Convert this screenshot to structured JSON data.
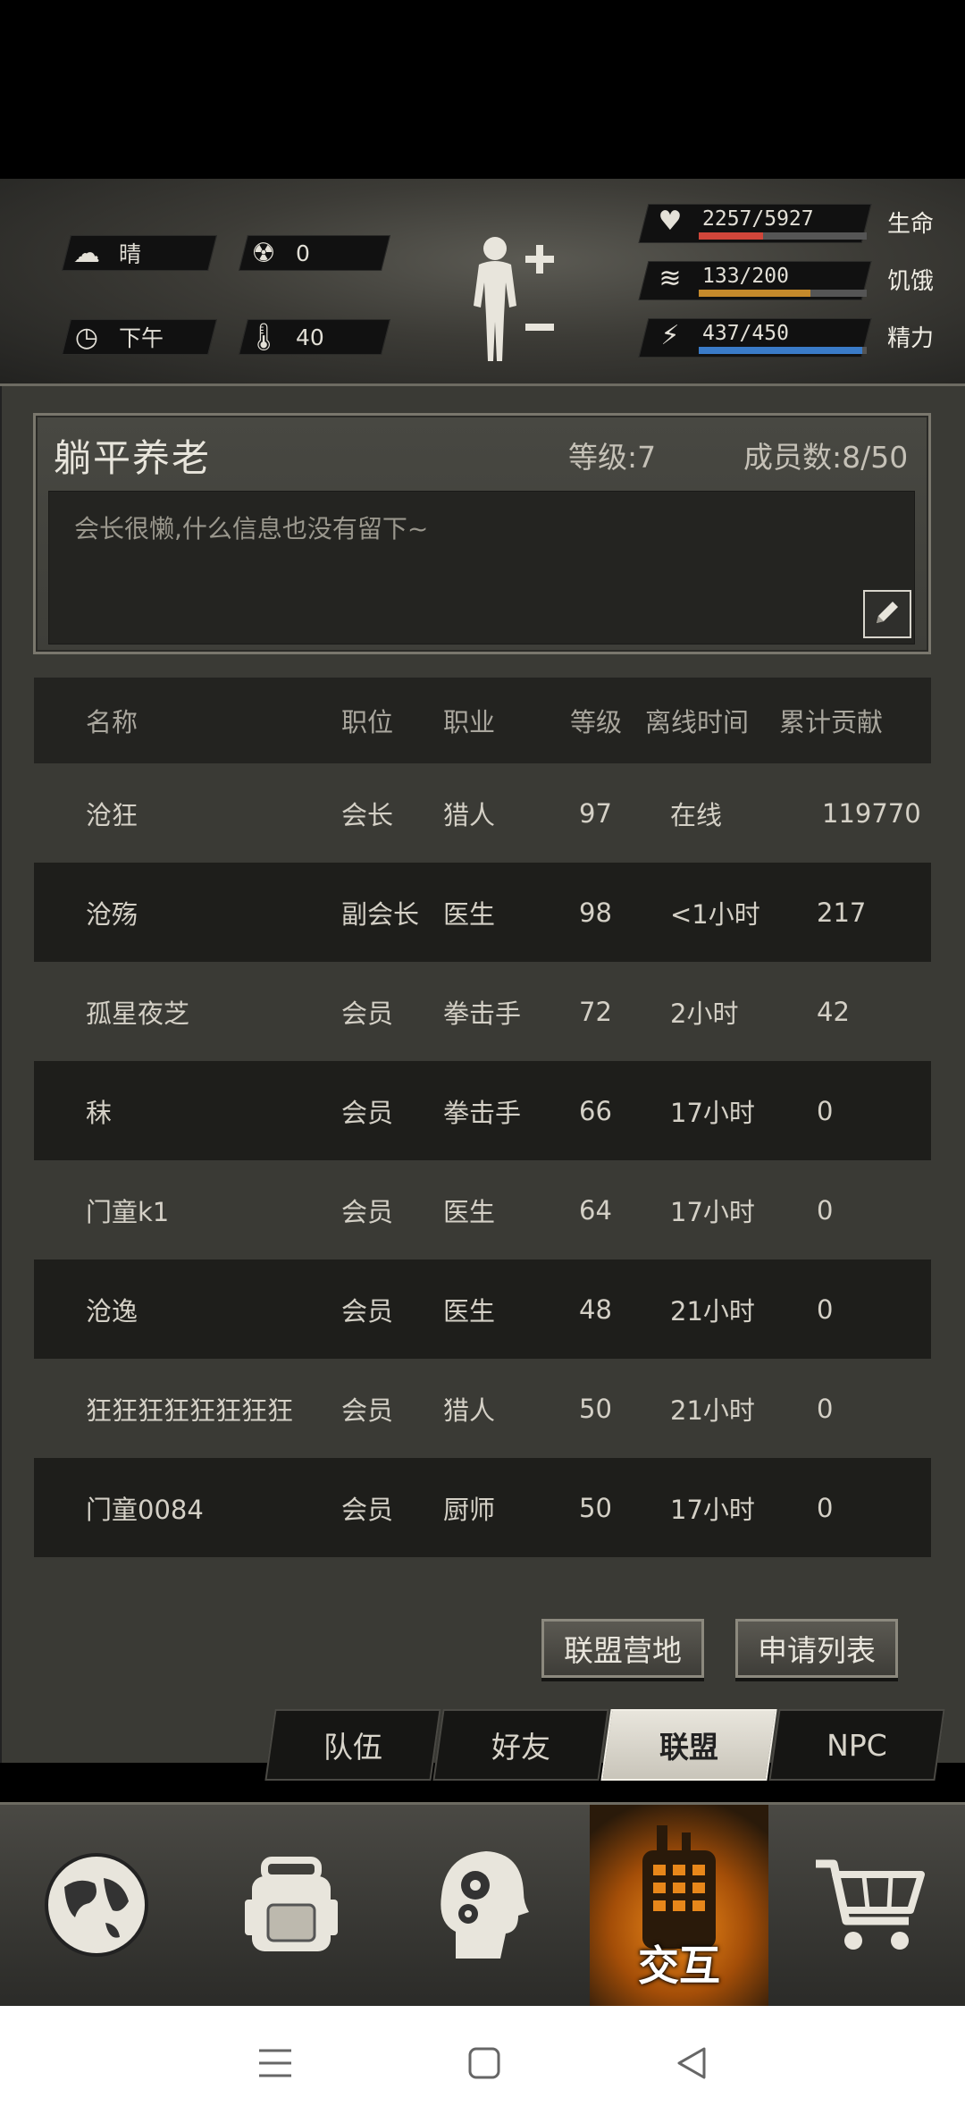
{
  "hud": {
    "weather": "晴",
    "radiation": "0",
    "time_of_day": "下午",
    "temperature": "40",
    "stats": [
      {
        "icon": "heart-icon",
        "value": "2257/5927",
        "label": "生命",
        "fraction": 0.381,
        "color": "#d0463a"
      },
      {
        "icon": "stomach-icon",
        "value": "133/200",
        "label": "饥饿",
        "fraction": 0.665,
        "color": "#c58a2b"
      },
      {
        "icon": "energy-icon",
        "value": "437/450",
        "label": "精力",
        "fraction": 0.971,
        "color": "#3a7bc8"
      }
    ]
  },
  "guild": {
    "name": "躺平养老",
    "level": "等级:7",
    "members": "成员数:8/50",
    "notice": "会长很懒,什么信息也没有留下~"
  },
  "table": {
    "headers": [
      "名称",
      "职位",
      "职业",
      "等级",
      "离线时间",
      "累计贡献"
    ],
    "rows": [
      [
        "沧狂",
        "会长",
        "猎人",
        "97",
        "在线",
        "119770"
      ],
      [
        "沧殇",
        "副会长",
        "医生",
        "98",
        "<1小时",
        "217"
      ],
      [
        "孤星夜芝",
        "会员",
        "拳击手",
        "72",
        "2小时",
        "42"
      ],
      [
        "秣",
        "会员",
        "拳击手",
        "66",
        "17小时",
        "0"
      ],
      [
        "门童k1",
        "会员",
        "医生",
        "64",
        "17小时",
        "0"
      ],
      [
        "沧逸",
        "会员",
        "医生",
        "48",
        "21小时",
        "0"
      ],
      [
        "狂狂狂狂狂狂狂狂",
        "会员",
        "猎人",
        "50",
        "21小时",
        "0"
      ],
      [
        "门童0084",
        "会员",
        "厨师",
        "50",
        "17小时",
        "0"
      ]
    ]
  },
  "actions": {
    "camp": "联盟营地",
    "applications": "申请列表"
  },
  "subtabs": [
    "队伍",
    "好友",
    "联盟",
    "NPC"
  ],
  "nav": {
    "active_label": "交互"
  }
}
